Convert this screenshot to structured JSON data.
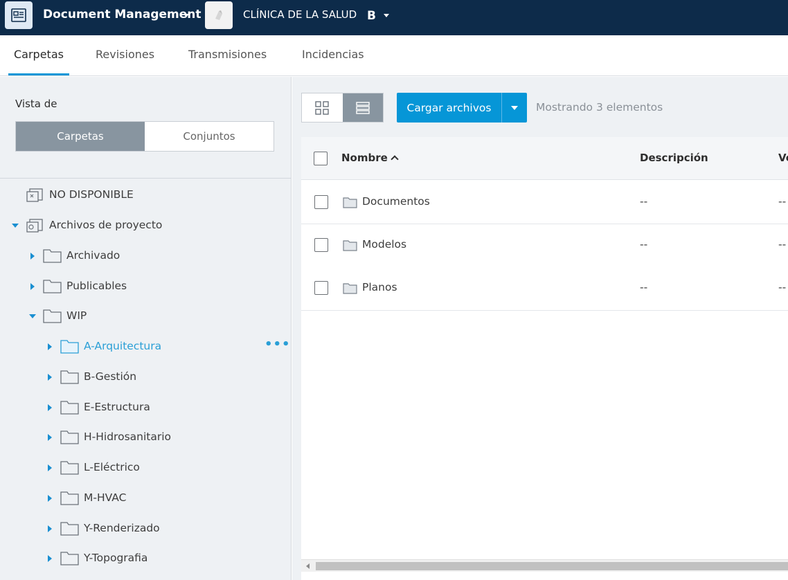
{
  "topbar": {
    "app_title": "Document Management",
    "project_name": "CLÍNICA DE LA SALUD",
    "project_logo": "B"
  },
  "tabs": [
    {
      "label": "Carpetas",
      "active": true
    },
    {
      "label": "Revisiones",
      "active": false
    },
    {
      "label": "Transmisiones",
      "active": false
    },
    {
      "label": "Incidencias",
      "active": false
    }
  ],
  "sidebar": {
    "vista_label": "Vista de",
    "segmented": {
      "carpetas": "Carpetas",
      "conjuntos": "Conjuntos",
      "selected": "Carpetas"
    },
    "tree": [
      {
        "label": "NO DISPONIBLE",
        "icon": "project-unavailable-icon",
        "state": "none"
      },
      {
        "label": "Archivos de proyecto",
        "icon": "project-files-icon",
        "state": "expanded"
      },
      {
        "label": "Archivado",
        "icon": "folder-icon",
        "state": "collapsed"
      },
      {
        "label": "Publicables",
        "icon": "folder-icon",
        "state": "collapsed"
      },
      {
        "label": "WIP",
        "icon": "folder-icon",
        "state": "expanded"
      },
      {
        "label": "A-Arquitectura",
        "icon": "folder-icon",
        "state": "collapsed",
        "selected": true
      },
      {
        "label": "B-Gestión",
        "icon": "folder-icon",
        "state": "collapsed"
      },
      {
        "label": "E-Estructura",
        "icon": "folder-icon",
        "state": "collapsed"
      },
      {
        "label": "H-Hidrosanitario",
        "icon": "folder-icon",
        "state": "collapsed"
      },
      {
        "label": "L-Eléctrico",
        "icon": "folder-icon",
        "state": "collapsed"
      },
      {
        "label": "M-HVAC",
        "icon": "folder-icon",
        "state": "collapsed"
      },
      {
        "label": "Y-Renderizado",
        "icon": "folder-icon",
        "state": "collapsed"
      },
      {
        "label": "Y-Topografia",
        "icon": "folder-icon",
        "state": "collapsed"
      }
    ]
  },
  "toolbar": {
    "upload_label": "Cargar archivos",
    "count_text": "Mostrando 3 elementos",
    "view_mode": "list"
  },
  "table": {
    "columns": [
      "Nombre",
      "Descripción",
      "Ve"
    ],
    "rows": [
      {
        "name": "Documentos",
        "description": "--",
        "version": "--"
      },
      {
        "name": "Modelos",
        "description": "--",
        "version": "--"
      },
      {
        "name": "Planos",
        "description": "--",
        "version": "--"
      }
    ]
  },
  "colors": {
    "topbar": "#0d2b4a",
    "accent": "#0696d7",
    "selected_segment": "#8895a0",
    "selected_tree_text": "#2a9fd6"
  }
}
